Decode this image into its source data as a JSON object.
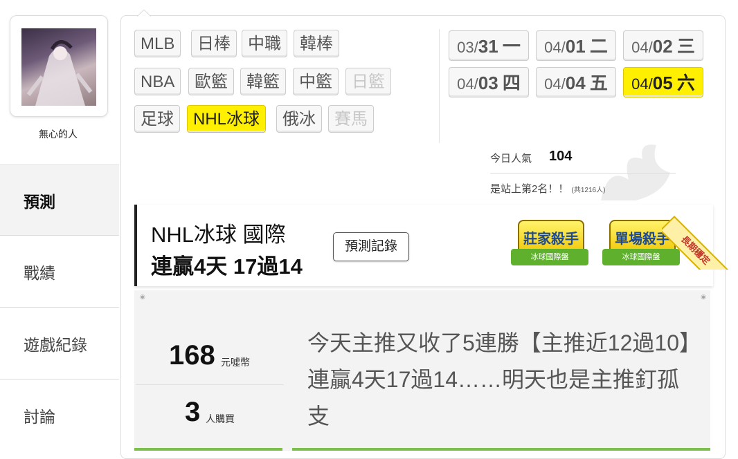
{
  "user": {
    "name": "無心的人"
  },
  "nav": [
    {
      "label": "預測",
      "active": true
    },
    {
      "label": "戰績",
      "active": false
    },
    {
      "label": "遊戲紀錄",
      "active": false
    },
    {
      "label": "討論",
      "active": false
    }
  ],
  "leagues": {
    "row1": [
      "MLB",
      "日棒",
      "中職",
      "韓棒"
    ],
    "row2": [
      "NBA",
      "歐籃",
      "韓籃",
      "中籃",
      "日籃"
    ],
    "row3": [
      "足球",
      "NHL冰球",
      "俄冰",
      "賽馬"
    ],
    "active": "NHL冰球",
    "disabled": [
      "日籃",
      "賽馬"
    ]
  },
  "dates": [
    {
      "md": "03/",
      "day": "31",
      "wd": "一"
    },
    {
      "md": "04/",
      "day": "01",
      "wd": "二"
    },
    {
      "md": "04/",
      "day": "02",
      "wd": "三"
    },
    {
      "md": "04/",
      "day": "03",
      "wd": "四"
    },
    {
      "md": "04/",
      "day": "04",
      "wd": "五"
    },
    {
      "md": "04/",
      "day": "05",
      "wd": "六",
      "active": true
    }
  ],
  "popularity": {
    "label": "今日人氣",
    "count": "104",
    "rank_text": "是站上第2名！！",
    "rank_total": "(共1216人)"
  },
  "prediction": {
    "title": "NHL冰球 國際",
    "streak": "連贏4天 17過14",
    "record_button": "預測記錄",
    "badges": [
      {
        "title": "莊家殺手",
        "ribbon": "冰球國際盤"
      },
      {
        "title": "單場殺手",
        "ribbon": "冰球國際盤"
      }
    ],
    "corner": "長期穩定"
  },
  "listing": {
    "price": "168",
    "price_unit": "元噓幣",
    "buyers": "3",
    "buyers_unit": "人購買",
    "description": "今天主推又收了5連勝【主推近12過10】連贏4天17過14……明天也是主推釘孤支"
  },
  "colors": {
    "active_yellow": "#ffef00",
    "ribbon_green": "#5fb02d",
    "bar_green": "#7cc04b"
  }
}
